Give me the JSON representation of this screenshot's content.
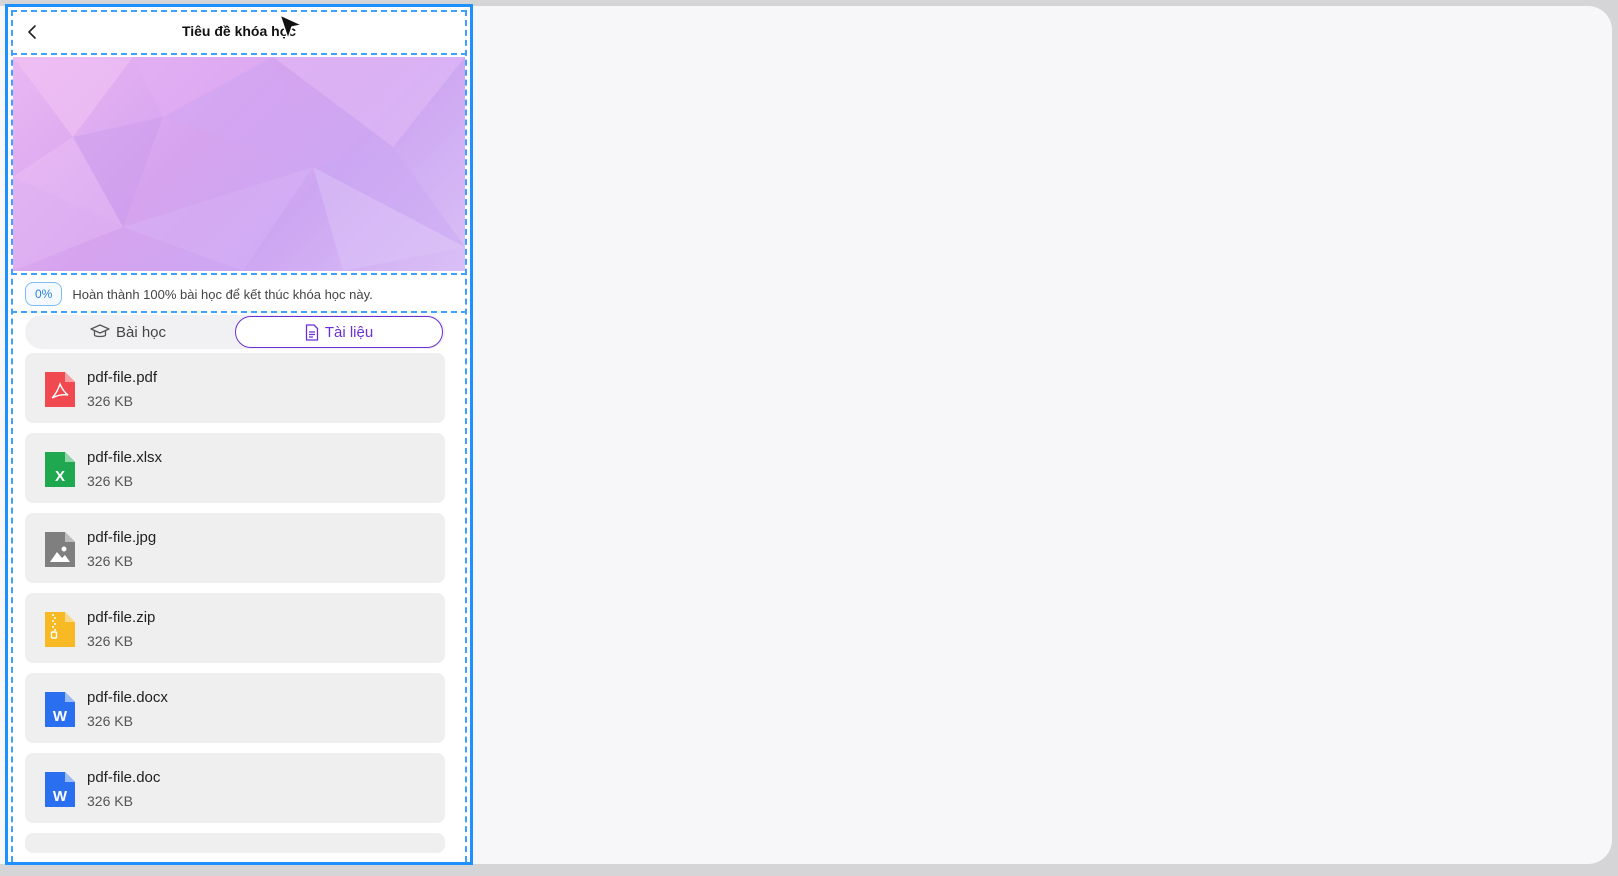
{
  "header": {
    "title": "Tiêu đề khóa học"
  },
  "progress": {
    "percent_label": "0%",
    "message": "Hoàn thành 100% bài học để kết thúc khóa học này."
  },
  "tabs": [
    {
      "label": "Bài học",
      "icon": "graduation-cap-icon",
      "active": false
    },
    {
      "label": "Tài liệu",
      "icon": "document-icon",
      "active": true
    }
  ],
  "files": [
    {
      "name": "pdf-file.pdf",
      "size": "326 KB",
      "type": "pdf",
      "color": "#f0494f",
      "glyph": ""
    },
    {
      "name": "pdf-file.xlsx",
      "size": "326 KB",
      "type": "xlsx",
      "color": "#1fa84f",
      "glyph": "X"
    },
    {
      "name": "pdf-file.jpg",
      "size": "326 KB",
      "type": "jpg",
      "color": "#7f7f7f",
      "glyph": ""
    },
    {
      "name": "pdf-file.zip",
      "size": "326 KB",
      "type": "zip",
      "color": "#f7b924",
      "glyph": ""
    },
    {
      "name": "pdf-file.docx",
      "size": "326 KB",
      "type": "docx",
      "color": "#2a6ff0",
      "glyph": "W"
    },
    {
      "name": "pdf-file.doc",
      "size": "326 KB",
      "type": "doc",
      "color": "#2a6ff0",
      "glyph": "W"
    }
  ],
  "colors": {
    "accent": "#6b2fd6",
    "selection": "#1e90ff",
    "badge": "#2a7fd4"
  }
}
